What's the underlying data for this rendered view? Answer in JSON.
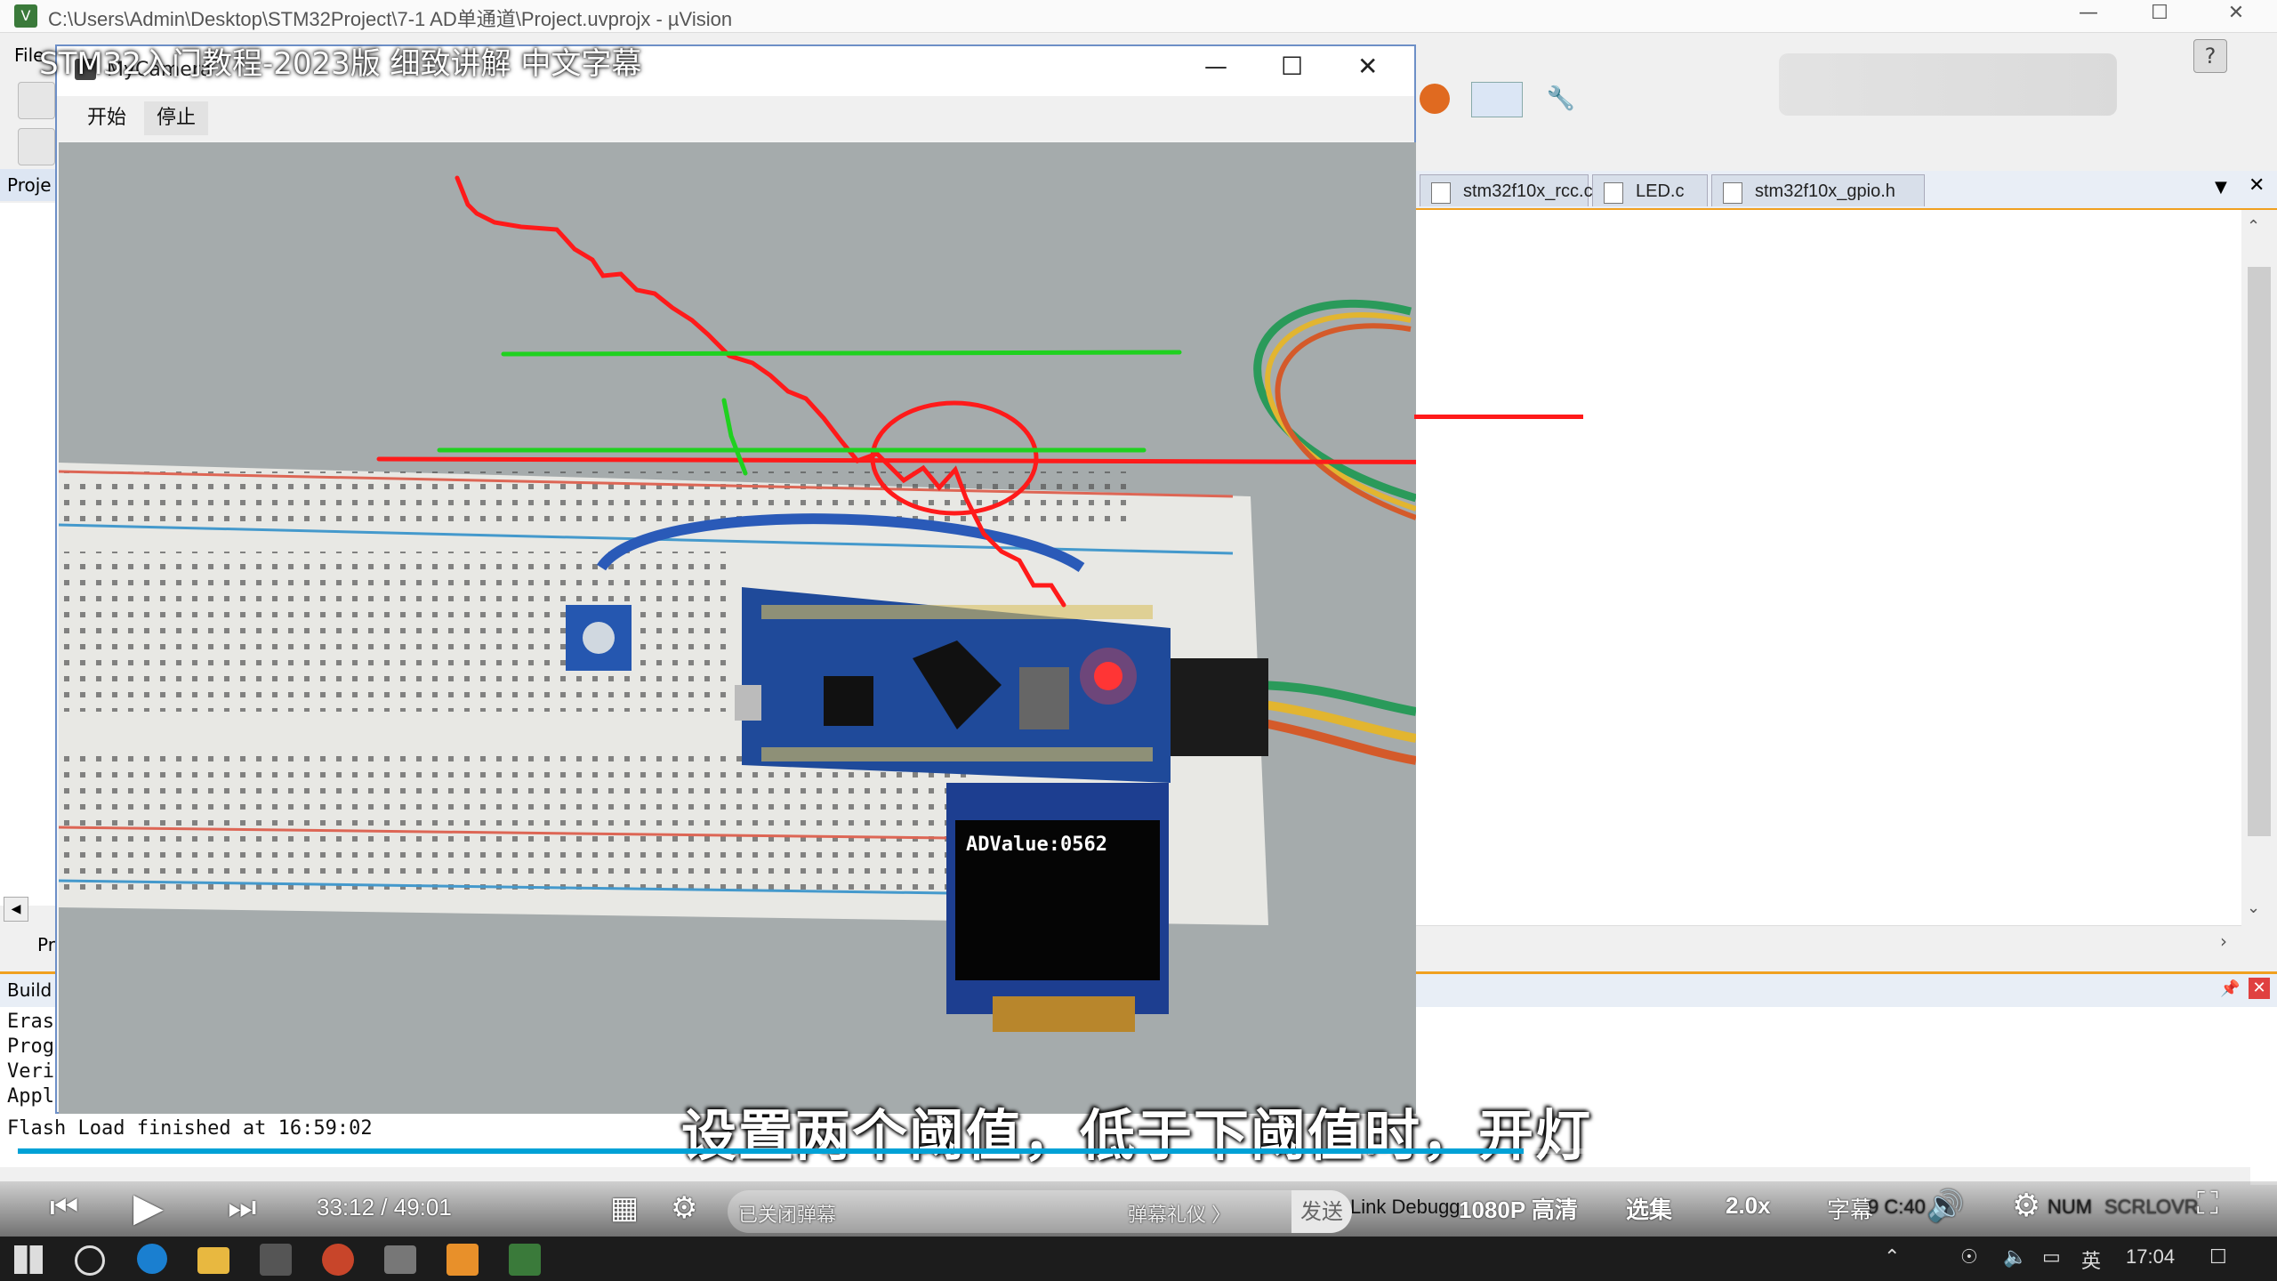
{
  "keil": {
    "title": "C:\\Users\\Admin\\Desktop\\STM32Project\\7-1 AD单通道\\Project.uvprojx - µVision",
    "menu_file": "File",
    "project_label": "Proje",
    "tabs": [
      "stm32f10x_rcc.c",
      "LED.c",
      "stm32f10x_gpio.h"
    ],
    "project_tab": "Pr",
    "build_label": "Build",
    "build_lines": [
      "Eras",
      "Prog",
      "Veri",
      "Appl"
    ],
    "build_last": "Flash Load finished at 16:59:02",
    "status": {
      "debugger": "Link Debugg",
      "pos": "9 C:40",
      "num": "NUM",
      "scrl": "SCRL",
      "ovr": "OVR"
    }
  },
  "camera": {
    "title": "MyCamera",
    "start": "开始",
    "stop": "停止",
    "oled_text": "ADValue:0562"
  },
  "video": {
    "title": "STM32入门教程-2023版 细致讲解 中文字幕",
    "subtitle": "设置两个阈值，低于下阈值时，开灯",
    "time": "33:12 / 49:01",
    "progress": 0.677,
    "danmaku_placeholder": "已关闭弹幕",
    "gift": "弹幕礼仪 〉",
    "send": "发送",
    "quality": "1080P 高清",
    "episodes": "选集",
    "speed": "2.0x",
    "subtitle_btn": "字幕"
  },
  "taskbar": {
    "ime": "英",
    "clock": "17:04"
  }
}
